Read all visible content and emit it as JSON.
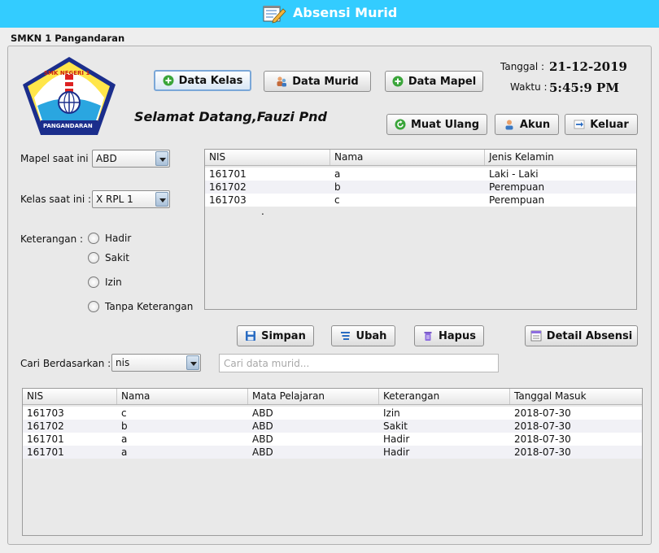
{
  "window": {
    "title": "Absensi Murid",
    "icon": "notepad-pencil-icon"
  },
  "school_name": "SMKN 1 Pangandaran",
  "logo": {
    "top_text": "SMK NEGERI 1",
    "bottom_text": "PANGANDARAN"
  },
  "nav": {
    "data_kelas": "Data Kelas",
    "data_murid": "Data Murid",
    "data_mapel": "Data Mapel"
  },
  "welcome": "Selamat Datang,Fauzi Pnd",
  "datetime": {
    "date_label": "Tanggal :",
    "date_value": "21-12-2019",
    "time_label": "Waktu :",
    "time_value": "5:45:9 PM"
  },
  "actions": {
    "reload": "Muat Ulang",
    "account": "Akun",
    "logout": "Keluar"
  },
  "form": {
    "mapel_label": "Mapel saat ini :",
    "mapel_value": "ABD",
    "kelas_label": "Kelas saat ini :",
    "kelas_value": "X RPL 1",
    "keterangan_label": "Keterangan :",
    "options": [
      "Hadir",
      "Sakit",
      "Izin",
      "Tanpa Keterangan"
    ]
  },
  "students_table": {
    "headers": [
      "NIS",
      "Nama",
      "Jenis Kelamin"
    ],
    "rows": [
      [
        "161701",
        "a",
        "Laki - Laki"
      ],
      [
        "161702",
        "b",
        "Perempuan"
      ],
      [
        "161703",
        "c",
        "Perempuan"
      ]
    ],
    "stray_mark": "."
  },
  "crud": {
    "save": "Simpan",
    "edit": "Ubah",
    "delete": "Hapus",
    "detail": "Detail Absensi"
  },
  "search": {
    "label": "Cari Berdasarkan :",
    "field_value": "nis",
    "placeholder": "Cari data murid..."
  },
  "attendance_table": {
    "headers": [
      "NIS",
      "Nama",
      "Mata Pelajaran",
      "Keterangan",
      "Tanggal Masuk"
    ],
    "rows": [
      [
        "161703",
        "c",
        "ABD",
        "Izin",
        "2018-07-30"
      ],
      [
        "161702",
        "b",
        "ABD",
        "Sakit",
        "2018-07-30"
      ],
      [
        "161701",
        "a",
        "ABD",
        "Hadir",
        "2018-07-30"
      ],
      [
        "161701",
        "a",
        "ABD",
        "Hadir",
        "2018-07-30"
      ]
    ]
  },
  "colors": {
    "title_bar": "#33ccff",
    "panel": "#e9e9e9",
    "plus_icon": "#3aa53a"
  }
}
